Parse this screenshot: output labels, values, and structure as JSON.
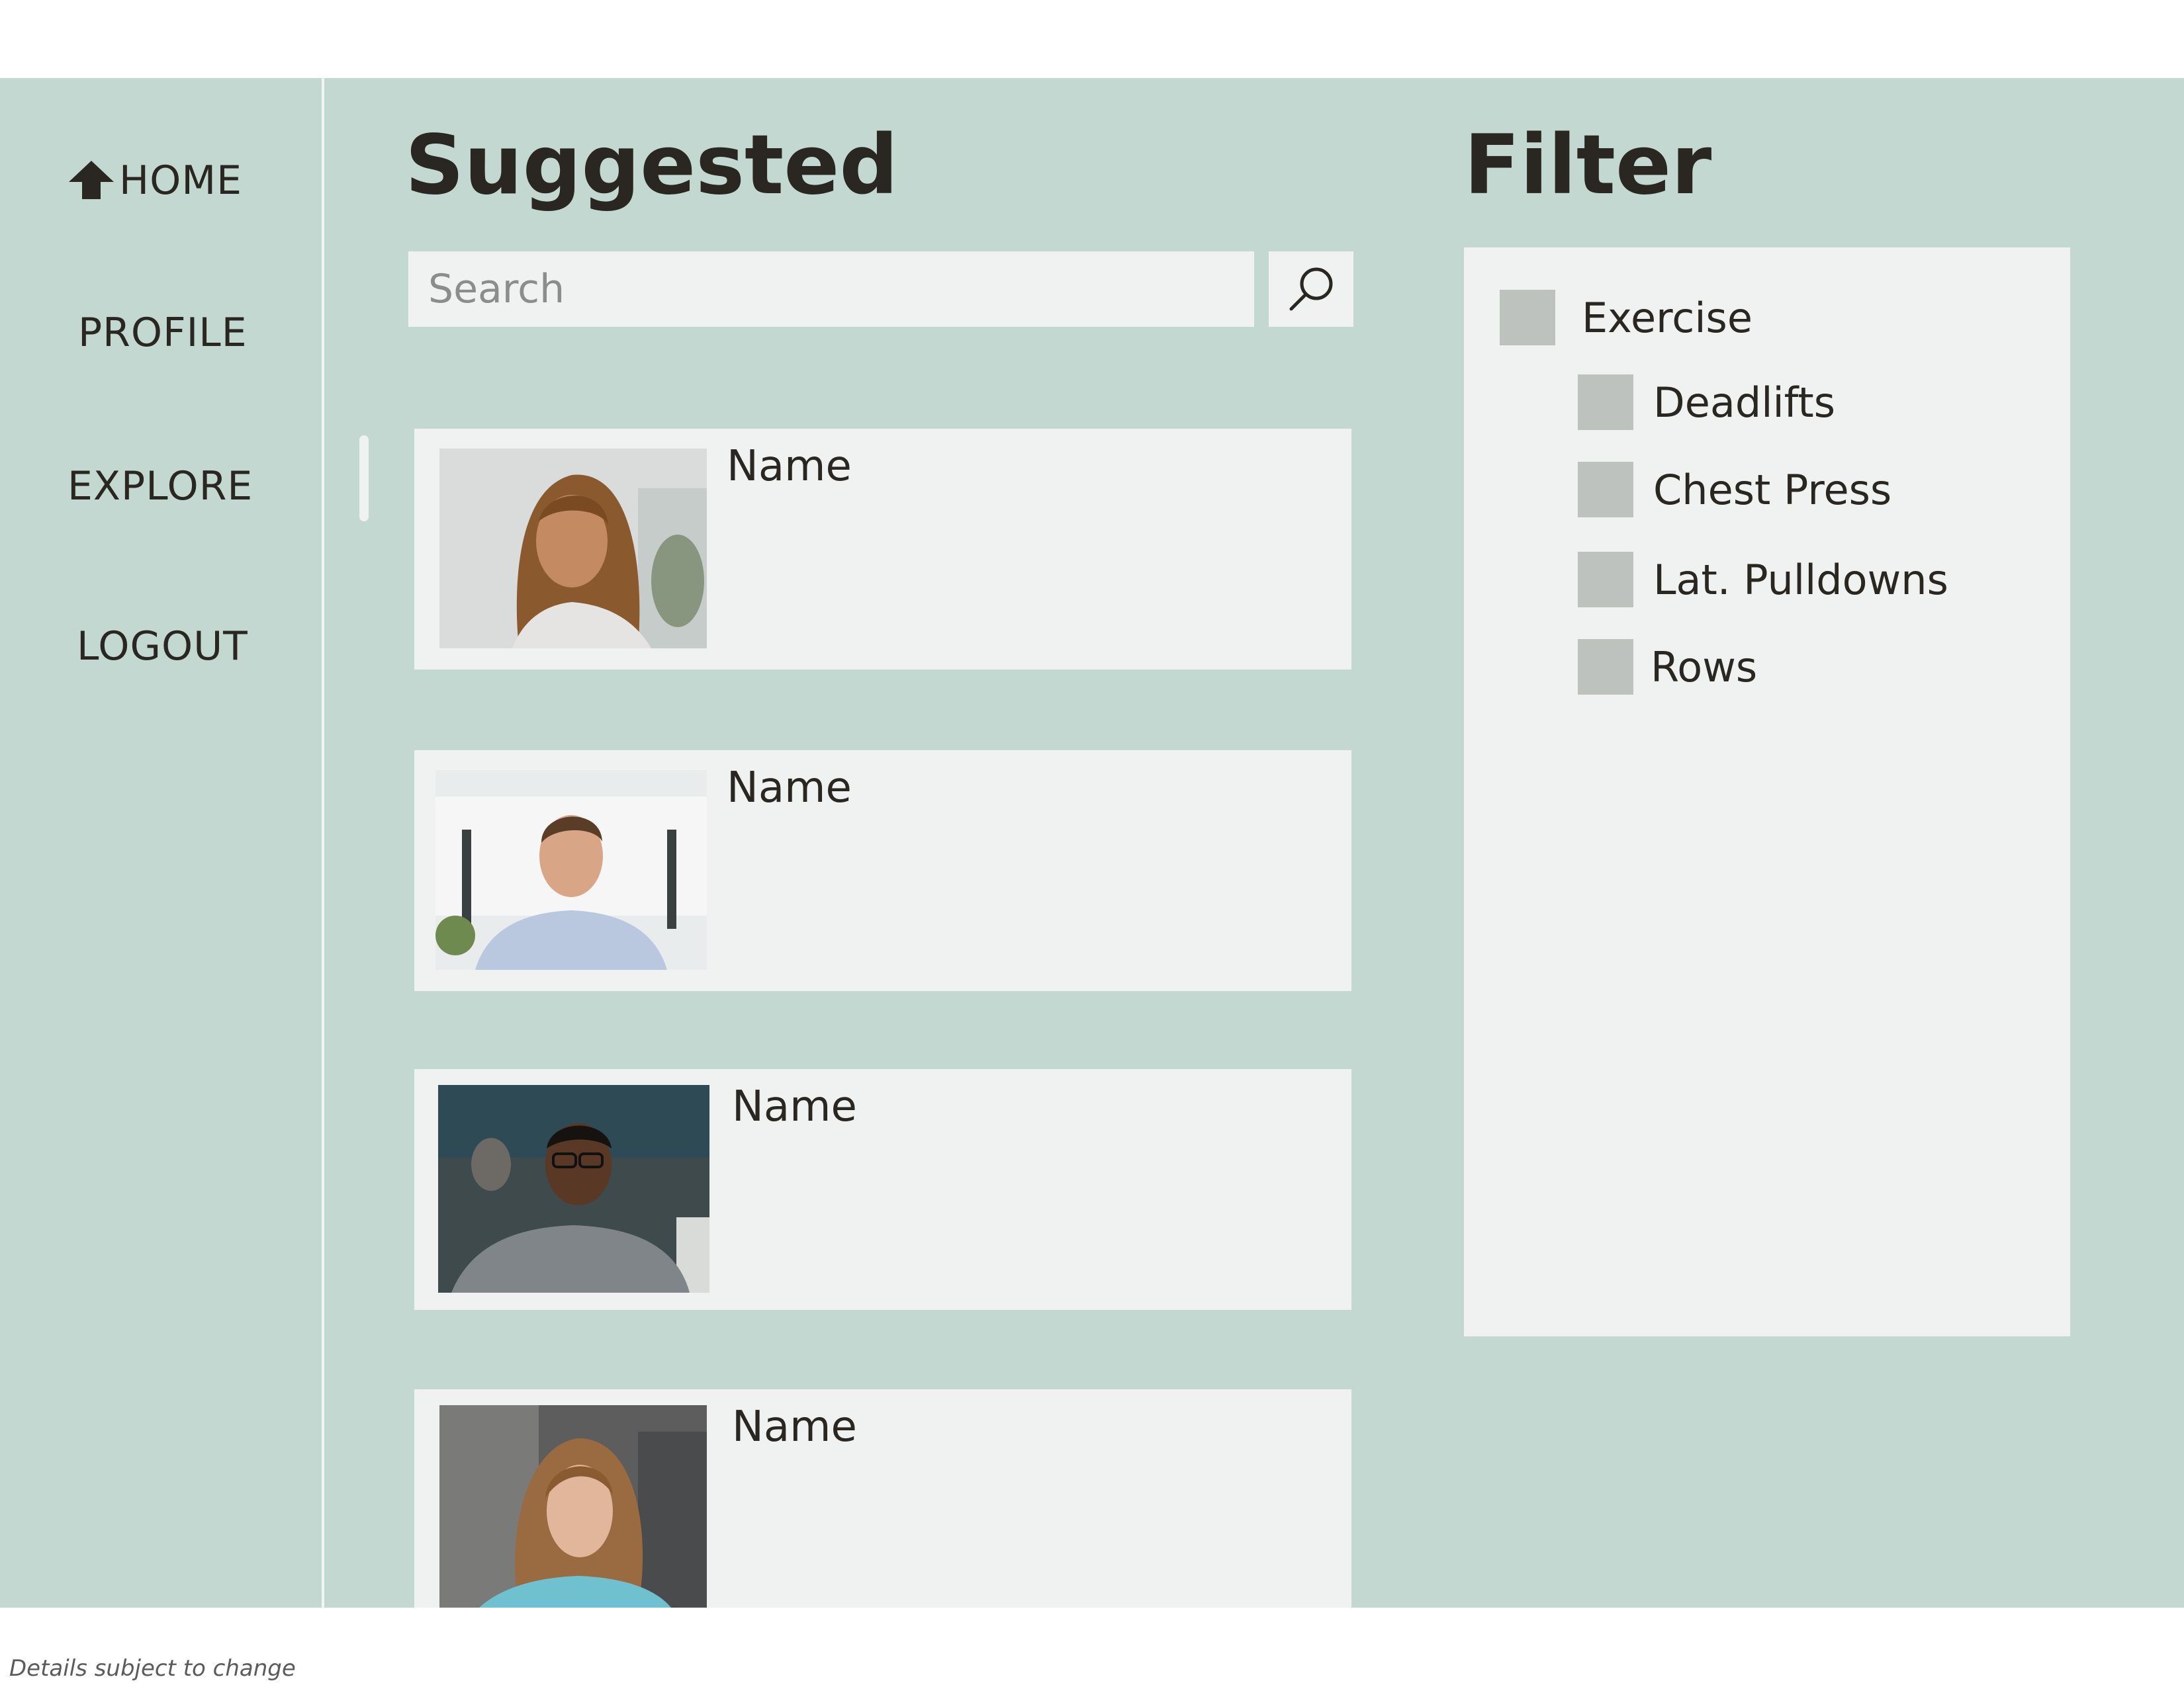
{
  "nav": {
    "home": "HOME",
    "profile": "PROFILE",
    "explore": "EXPLORE",
    "logout": "LOGOUT"
  },
  "main": {
    "title": "Suggested",
    "search_placeholder": "Search",
    "cards": [
      {
        "name": "Name"
      },
      {
        "name": "Name"
      },
      {
        "name": "Name"
      },
      {
        "name": "Name"
      }
    ]
  },
  "filter": {
    "title": "Filter",
    "parent": "Exercise",
    "options": [
      "Deadlifts",
      "Chest Press",
      "Lat. Pulldowns",
      "Rows"
    ]
  },
  "footer": {
    "note": "Details subject to change"
  },
  "colors": {
    "background": "#c3d8d1",
    "panel": "#eff2f0",
    "checkbox": "#bec2bf",
    "text": "#2a2622"
  }
}
